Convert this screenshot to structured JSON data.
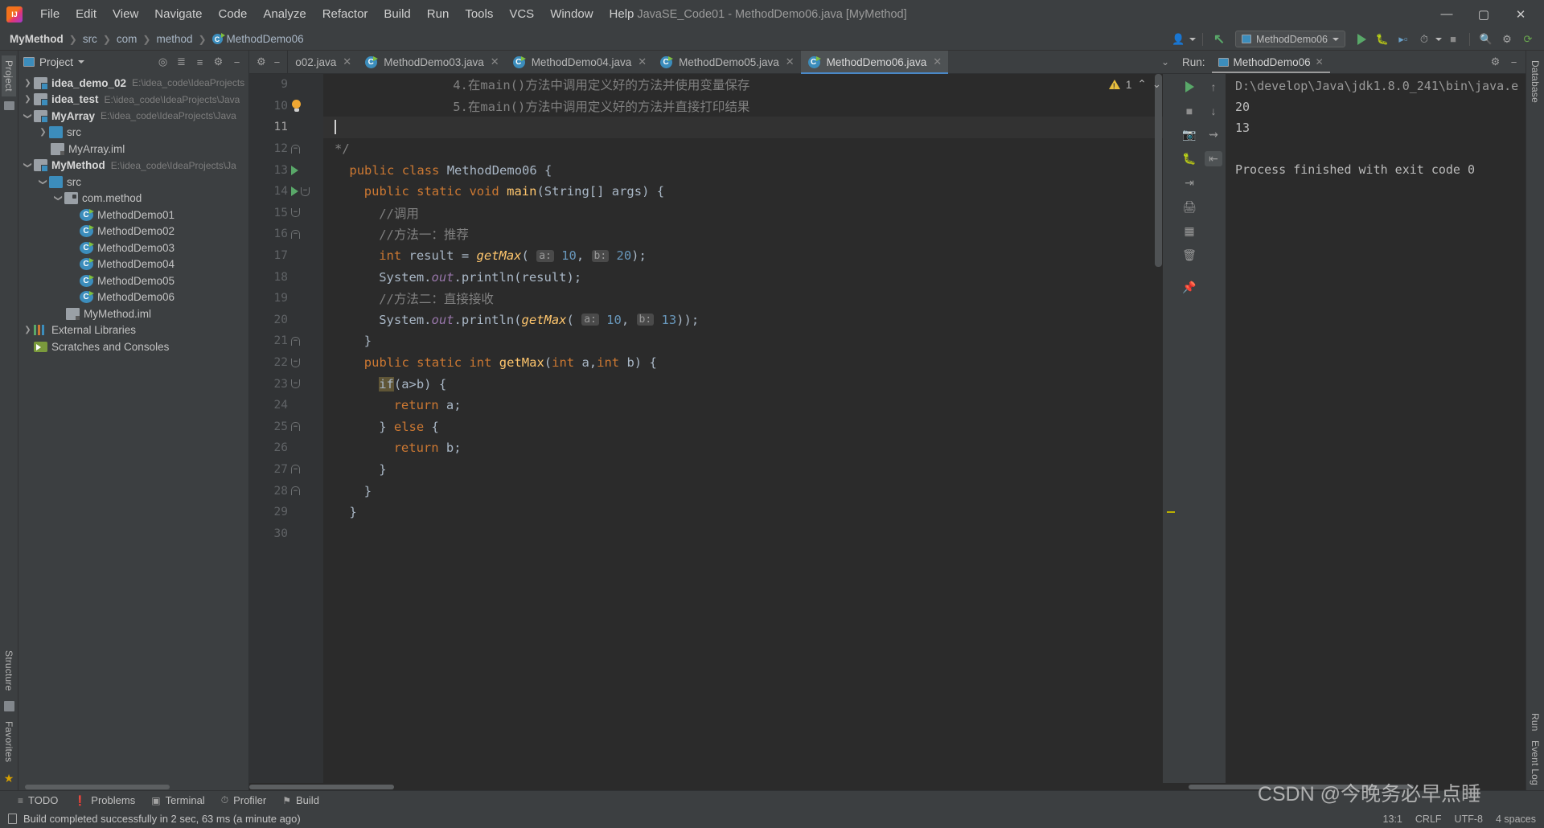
{
  "window": {
    "title": "JavaSE_Code01 - MethodDemo06.java [MyMethod]",
    "minimize": "—",
    "maximize": "▢",
    "close": "✕"
  },
  "menu": {
    "items": [
      "File",
      "Edit",
      "View",
      "Navigate",
      "Code",
      "Analyze",
      "Refactor",
      "Build",
      "Run",
      "Tools",
      "VCS",
      "Window",
      "Help"
    ]
  },
  "breadcrumb": {
    "items": [
      "MyMethod",
      "src",
      "com",
      "method",
      "MethodDemo06"
    ],
    "separator": "❯"
  },
  "toolbar": {
    "run_config": "MethodDemo06",
    "run_icon": "run-icon",
    "debug_icon": "debug-icon",
    "coverage_icon": "coverage-icon",
    "profile_icon": "profile-icon",
    "stop_icon": "stop-icon",
    "search_icon": "search-icon",
    "settings_icon": "settings-icon",
    "updates_icon": "updates-icon",
    "user_icon": "user-icon",
    "vcs_icon": "vcs-update-icon"
  },
  "left_strip": {
    "project_tab": "Project",
    "structure_tab": "Structure",
    "favorites_tab": "Favorites"
  },
  "right_strip": {
    "database_tab": "Database",
    "run_tab": "Run",
    "event_log_tab": "Event Log"
  },
  "project_panel": {
    "title": "Project",
    "icons": [
      "locate-icon",
      "expand-all-icon",
      "collapse-all-icon",
      "settings-icon",
      "hide-icon"
    ],
    "tree": [
      {
        "indent": 0,
        "arrow": "right",
        "icon": "module-icon",
        "label": "idea_demo_02",
        "bold": true,
        "path": "E:\\idea_code\\IdeaProjects"
      },
      {
        "indent": 0,
        "arrow": "right",
        "icon": "module-icon",
        "label": "idea_test",
        "bold": true,
        "path": "E:\\idea_code\\IdeaProjects\\Java"
      },
      {
        "indent": 0,
        "arrow": "down",
        "icon": "module-icon",
        "label": "MyArray",
        "bold": true,
        "path": "E:\\idea_code\\IdeaProjects\\Java"
      },
      {
        "indent": 1,
        "arrow": "right",
        "icon": "source-folder-icon",
        "label": "src",
        "bold": false,
        "path": ""
      },
      {
        "indent": 1,
        "arrow": "none",
        "icon": "iml-file-icon",
        "label": "MyArray.iml",
        "bold": false,
        "path": ""
      },
      {
        "indent": 0,
        "arrow": "down",
        "icon": "module-icon",
        "label": "MyMethod",
        "bold": true,
        "path": "E:\\idea_code\\IdeaProjects\\Ja"
      },
      {
        "indent": 1,
        "arrow": "down",
        "icon": "source-folder-icon",
        "label": "src",
        "bold": false,
        "path": ""
      },
      {
        "indent": 2,
        "arrow": "down",
        "icon": "package-icon",
        "label": "com.method",
        "bold": false,
        "path": ""
      },
      {
        "indent": 3,
        "arrow": "none",
        "icon": "java-class-icon",
        "label": "MethodDemo01",
        "bold": false,
        "path": ""
      },
      {
        "indent": 3,
        "arrow": "none",
        "icon": "java-class-icon",
        "label": "MethodDemo02",
        "bold": false,
        "path": ""
      },
      {
        "indent": 3,
        "arrow": "none",
        "icon": "java-class-icon",
        "label": "MethodDemo03",
        "bold": false,
        "path": ""
      },
      {
        "indent": 3,
        "arrow": "none",
        "icon": "java-class-icon",
        "label": "MethodDemo04",
        "bold": false,
        "path": ""
      },
      {
        "indent": 3,
        "arrow": "none",
        "icon": "java-class-icon",
        "label": "MethodDemo05",
        "bold": false,
        "path": ""
      },
      {
        "indent": 3,
        "arrow": "none",
        "icon": "java-class-icon",
        "label": "MethodDemo06",
        "bold": false,
        "path": ""
      },
      {
        "indent": 2,
        "arrow": "none",
        "icon": "iml-file-icon",
        "label": "MyMethod.iml",
        "bold": false,
        "path": ""
      },
      {
        "indent": 0,
        "arrow": "right",
        "icon": "libraries-icon",
        "label": "External Libraries",
        "bold": false,
        "path": ""
      },
      {
        "indent": 0,
        "arrow": "none",
        "icon": "scratches-icon",
        "label": "Scratches and Consoles",
        "bold": false,
        "path": ""
      }
    ]
  },
  "editor": {
    "tabs": [
      {
        "label": "o02.java",
        "active": false,
        "truncated": true
      },
      {
        "label": "MethodDemo03.java",
        "active": false,
        "truncated": false
      },
      {
        "label": "MethodDemo04.java",
        "active": false,
        "truncated": false
      },
      {
        "label": "MethodDemo05.java",
        "active": false,
        "truncated": false
      },
      {
        "label": "MethodDemo06.java",
        "active": true,
        "truncated": false
      }
    ],
    "tab_close": "✕",
    "tab_list_chevron": "⌄",
    "warning_count": "1",
    "warning_up": "⌃",
    "warning_down": "⌄",
    "lines": [
      {
        "no": "9",
        "gutter": "",
        "indent": 8,
        "tokens": [
          {
            "t": "cmt",
            "v": "4.在main()方法中调用定义好的方法并使用变量保存"
          }
        ]
      },
      {
        "no": "10",
        "gutter": "bulb",
        "indent": 8,
        "tokens": [
          {
            "t": "cmt",
            "v": "5.在main()方法中调用定义好的方法并直接打印结果"
          }
        ]
      },
      {
        "no": "11",
        "gutter": "",
        "indent": 0,
        "current": true,
        "tokens": []
      },
      {
        "no": "12",
        "gutter": "fold-up",
        "indent": 0,
        "tokens": [
          {
            "t": "cmt",
            "v": "*/"
          }
        ]
      },
      {
        "no": "13",
        "gutter": "run",
        "indent": 1,
        "tokens": [
          {
            "t": "kw",
            "v": "public "
          },
          {
            "t": "kw",
            "v": "class "
          },
          {
            "t": "plain",
            "v": "MethodDemo06 {"
          }
        ]
      },
      {
        "no": "14",
        "gutter": "run+fold-down",
        "indent": 2,
        "tokens": [
          {
            "t": "kw",
            "v": "public static void "
          },
          {
            "t": "mname",
            "v": "main"
          },
          {
            "t": "plain",
            "v": "("
          },
          {
            "t": "plain",
            "v": "String[] args) {"
          }
        ]
      },
      {
        "no": "15",
        "gutter": "fold-down",
        "indent": 3,
        "tokens": [
          {
            "t": "cmt",
            "v": "//调用"
          }
        ]
      },
      {
        "no": "16",
        "gutter": "fold-up",
        "indent": 3,
        "tokens": [
          {
            "t": "cmt",
            "v": "//方法一：推荐"
          }
        ]
      },
      {
        "no": "17",
        "gutter": "",
        "indent": 3,
        "tokens": [
          {
            "t": "kw",
            "v": "int "
          },
          {
            "t": "plain",
            "v": "result = "
          },
          {
            "t": "mcall",
            "v": "getMax"
          },
          {
            "t": "plain",
            "v": "( "
          },
          {
            "t": "hint",
            "v": "a:"
          },
          {
            "t": "num",
            "v": " 10"
          },
          {
            "t": "plain",
            "v": ", "
          },
          {
            "t": "hint",
            "v": "b:"
          },
          {
            "t": "num",
            "v": " 20"
          },
          {
            "t": "plain",
            "v": ");"
          }
        ]
      },
      {
        "no": "18",
        "gutter": "",
        "indent": 3,
        "tokens": [
          {
            "t": "plain",
            "v": "System."
          },
          {
            "t": "fld",
            "v": "out"
          },
          {
            "t": "plain",
            "v": ".println(result);"
          }
        ]
      },
      {
        "no": "19",
        "gutter": "",
        "indent": 3,
        "tokens": [
          {
            "t": "cmt",
            "v": "//方法二：直接接收"
          }
        ]
      },
      {
        "no": "20",
        "gutter": "",
        "indent": 3,
        "tokens": [
          {
            "t": "plain",
            "v": "System."
          },
          {
            "t": "fld",
            "v": "out"
          },
          {
            "t": "plain",
            "v": ".println("
          },
          {
            "t": "mcall",
            "v": "getMax"
          },
          {
            "t": "plain",
            "v": "( "
          },
          {
            "t": "hint",
            "v": "a:"
          },
          {
            "t": "num",
            "v": " 10"
          },
          {
            "t": "plain",
            "v": ", "
          },
          {
            "t": "hint",
            "v": "b:"
          },
          {
            "t": "num",
            "v": " 13"
          },
          {
            "t": "plain",
            "v": "));"
          }
        ]
      },
      {
        "no": "21",
        "gutter": "fold-up",
        "indent": 2,
        "tokens": [
          {
            "t": "plain",
            "v": "}"
          }
        ]
      },
      {
        "no": "22",
        "gutter": "fold-down",
        "indent": 2,
        "tokens": [
          {
            "t": "kw",
            "v": "public static int "
          },
          {
            "t": "mname",
            "v": "getMax"
          },
          {
            "t": "plain",
            "v": "("
          },
          {
            "t": "kw",
            "v": "int "
          },
          {
            "t": "plain",
            "v": "a,"
          },
          {
            "t": "kw",
            "v": "int "
          },
          {
            "t": "plain",
            "v": "b) {"
          }
        ]
      },
      {
        "no": "23",
        "gutter": "fold-down",
        "indent": 3,
        "tokens": [
          {
            "t": "sel-if",
            "v": "if"
          },
          {
            "t": "plain",
            "v": "(a>b) {"
          }
        ]
      },
      {
        "no": "24",
        "gutter": "",
        "indent": 4,
        "tokens": [
          {
            "t": "kw",
            "v": "return "
          },
          {
            "t": "plain",
            "v": "a;"
          }
        ]
      },
      {
        "no": "25",
        "gutter": "fold-up",
        "indent": 3,
        "tokens": [
          {
            "t": "plain",
            "v": "} "
          },
          {
            "t": "kw",
            "v": "else"
          },
          {
            "t": "plain",
            "v": " {"
          }
        ]
      },
      {
        "no": "26",
        "gutter": "",
        "indent": 4,
        "tokens": [
          {
            "t": "kw",
            "v": "return "
          },
          {
            "t": "plain",
            "v": "b;"
          }
        ]
      },
      {
        "no": "27",
        "gutter": "fold-up",
        "indent": 3,
        "tokens": [
          {
            "t": "plain",
            "v": "}"
          }
        ]
      },
      {
        "no": "28",
        "gutter": "fold-up",
        "indent": 2,
        "tokens": [
          {
            "t": "plain",
            "v": "}"
          }
        ]
      },
      {
        "no": "29",
        "gutter": "",
        "indent": 1,
        "tokens": [
          {
            "t": "plain",
            "v": "}"
          }
        ]
      },
      {
        "no": "30",
        "gutter": "",
        "indent": 0,
        "tokens": []
      }
    ]
  },
  "run_panel": {
    "label": "Run:",
    "tab_title": "MethodDemo06",
    "tab_close": "✕",
    "settings_icon": "settings-icon",
    "hide_icon": "hide-icon",
    "tools": [
      "rerun-icon",
      "stop-icon",
      "screenshot-icon",
      "debug-icon",
      "export-icon",
      "print-icon",
      "layout-icon",
      "trash-icon",
      "pin-icon"
    ],
    "tools2": [
      "scroll-up-icon",
      "scroll-down-icon",
      "soft-wrap-icon",
      "scroll-to-end-icon"
    ],
    "console": [
      {
        "text": "D:\\develop\\Java\\jdk1.8.0_241\\bin\\java.e",
        "dim": true
      },
      {
        "text": "20",
        "dim": false
      },
      {
        "text": "13",
        "dim": false
      },
      {
        "text": "",
        "dim": false
      },
      {
        "text": "Process finished with exit code 0",
        "dim": false
      }
    ]
  },
  "bottom_bar": {
    "items": [
      {
        "label": "TODO",
        "icon": "todo-icon"
      },
      {
        "label": "Problems",
        "icon": "problems-icon"
      },
      {
        "label": "Terminal",
        "icon": "terminal-icon"
      },
      {
        "label": "Profiler",
        "icon": "profiler-icon"
      },
      {
        "label": "Build",
        "icon": "build-icon"
      }
    ]
  },
  "status_bar": {
    "message": "Build completed successfully in 2 sec, 63 ms (a minute ago)",
    "caret": "13:1",
    "line_sep": "CRLF",
    "encoding": "UTF-8",
    "indent": "4 spaces"
  },
  "watermark": "CSDN @今晚务必早点睡"
}
